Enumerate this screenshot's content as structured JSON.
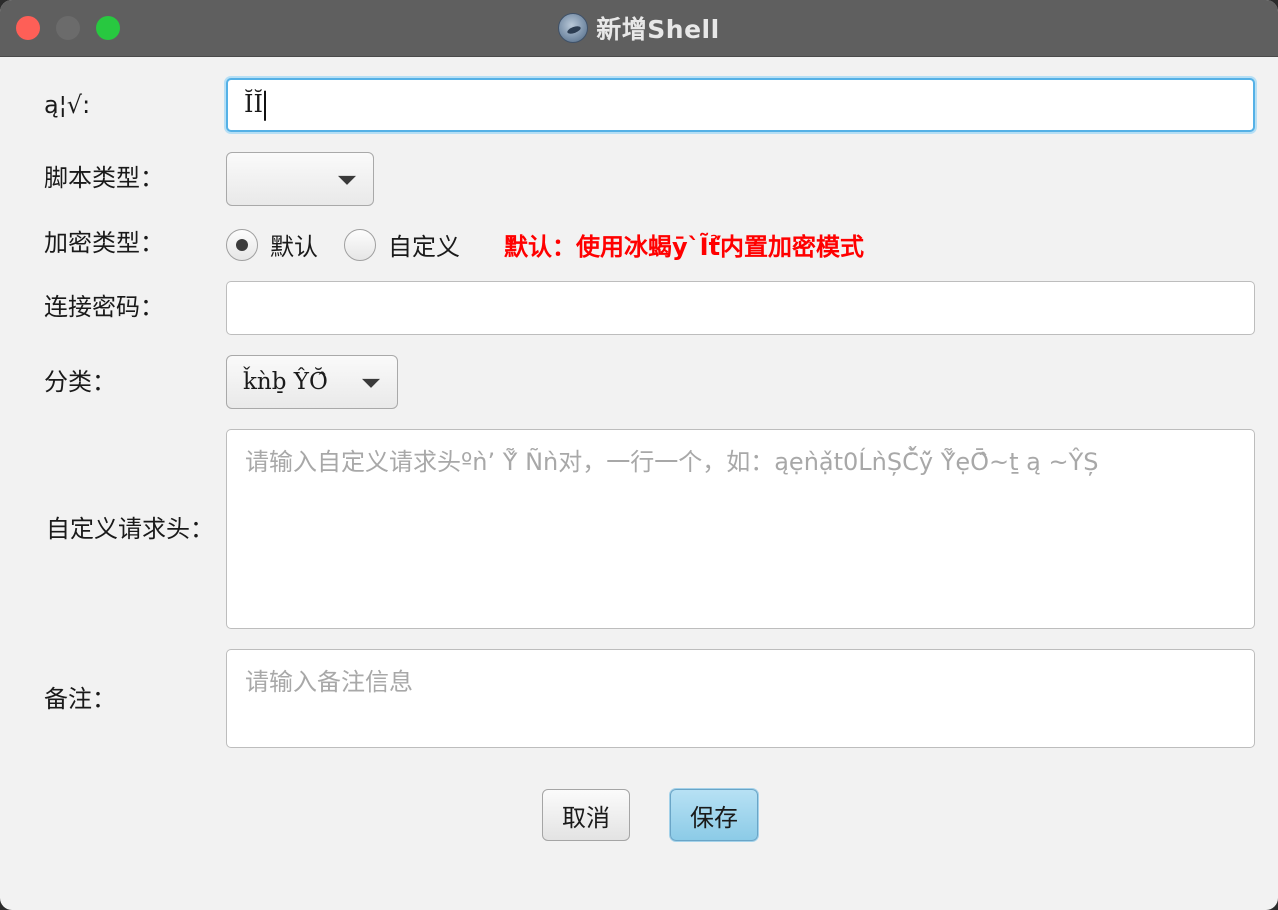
{
  "window": {
    "title": "新增Shell"
  },
  "form": {
    "url": {
      "label": "ą¦√:",
      "value": "ĬĬ"
    },
    "script_type": {
      "label": "脚本类型：",
      "selected": ""
    },
    "encrypt_type": {
      "label": "加密类型：",
      "options": [
        {
          "label": "默认",
          "checked": true
        },
        {
          "label": "自定义",
          "checked": false
        }
      ],
      "hint": "默认：使用冰蝎ȳ`Ĩť̉内置加密模式"
    },
    "password": {
      "label": "连接密码：",
      "value": ""
    },
    "category": {
      "label": "分类：",
      "selected": "ǩǹb̠ ŶŎ̂"
    },
    "custom_headers": {
      "label": "自定义请求头：",
      "placeholder": "请输入自定义请求头ºǹ’ Ỹ̌ Ñǹ对，一行一个，如：ąẹǹạ̌t0ĹǹȘČ̈̌ỹ̌ Ỹ̌ẹŌ̂~ṯ ą ~ŶȘ"
    },
    "remark": {
      "label": "备注：",
      "placeholder": "请输入备注信息"
    }
  },
  "buttons": {
    "cancel": "取消",
    "save": "保存"
  }
}
